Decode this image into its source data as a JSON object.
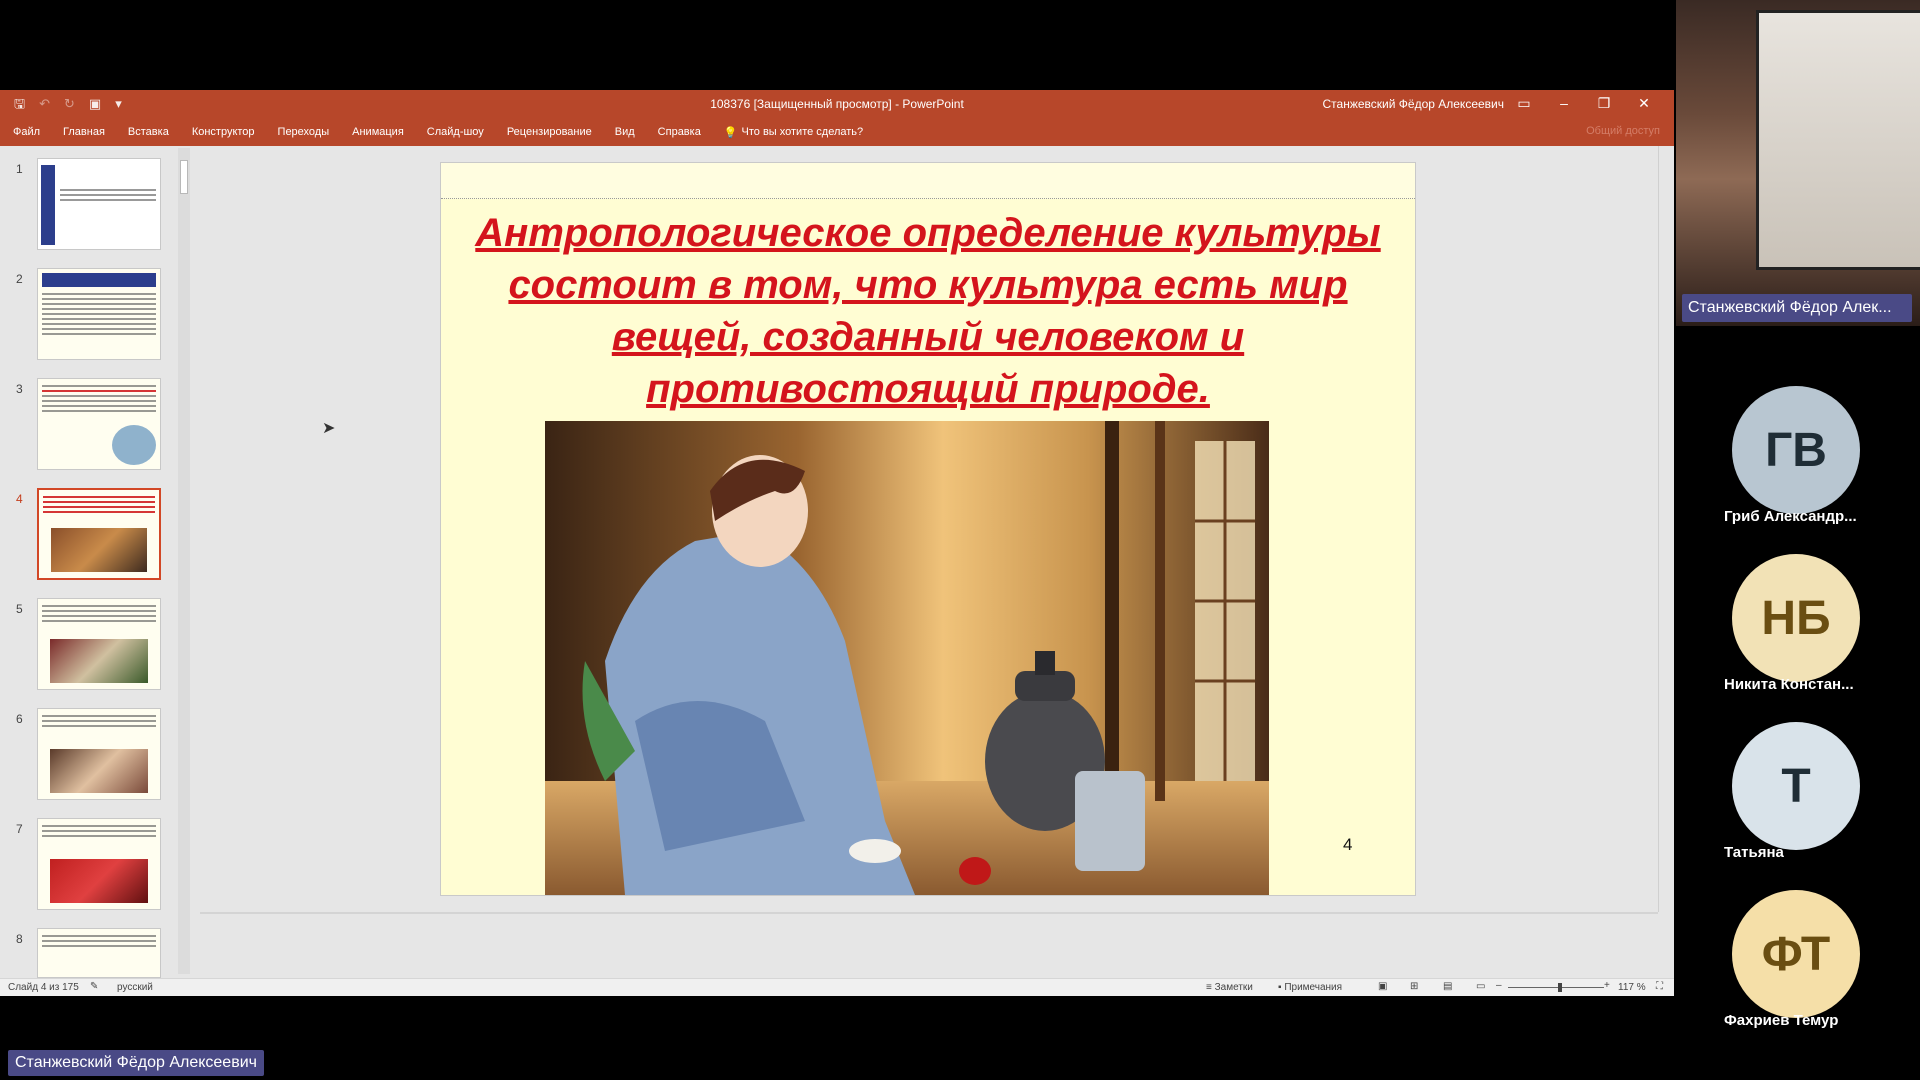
{
  "window": {
    "title": "108376 [Защищенный просмотр]  -  PowerPoint",
    "user": "Станжевский Фёдор Алексеевич",
    "share_label": "Общий доступ"
  },
  "ribbon": {
    "tabs": [
      "Файл",
      "Главная",
      "Вставка",
      "Конструктор",
      "Переходы",
      "Анимация",
      "Слайд-шоу",
      "Рецензирование",
      "Вид",
      "Справка"
    ],
    "tell_me": "Что вы хотите сделать?"
  },
  "thumbnails": {
    "items": [
      {
        "num": "1"
      },
      {
        "num": "2"
      },
      {
        "num": "3"
      },
      {
        "num": "4"
      },
      {
        "num": "5"
      },
      {
        "num": "6"
      },
      {
        "num": "7"
      },
      {
        "num": "8"
      }
    ],
    "active_index": 3
  },
  "slide": {
    "title": "Антропологическое определение культуры состоит в том, что культура есть мир вещей, созданный человеком и противостоящий природе.",
    "number": "4"
  },
  "status": {
    "slide_info": "Слайд 4 из 175",
    "language": "русский",
    "notes": "Заметки",
    "comments": "Примечания",
    "zoom": "117 %"
  },
  "meeting": {
    "speaker_label": "Станжевский Фёдор Алек...",
    "bottom_label": "Станжевский Фёдор Алексеевич",
    "participants": [
      {
        "initials": "ГВ",
        "name": "Гриб Александр...",
        "bg": "#b8c6d1",
        "fg": "#1f2d36"
      },
      {
        "initials": "НБ",
        "name": "Никита Констан...",
        "bg": "#f2e2b6",
        "fg": "#6a4e12"
      },
      {
        "initials": "Т",
        "name": "Татьяна",
        "bg": "#d9e3ea",
        "fg": "#1f2d36"
      },
      {
        "initials": "ФТ",
        "name": "Фахриев Темур",
        "bg": "#f5dfa8",
        "fg": "#6a4e12"
      }
    ]
  }
}
